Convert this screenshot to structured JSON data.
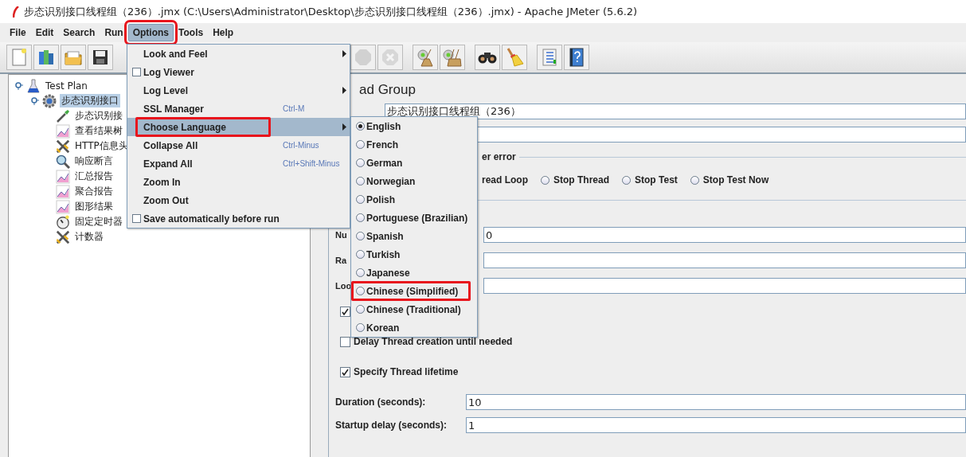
{
  "window": {
    "title": "步态识别接口线程组（236）.jmx (C:\\Users\\Administrator\\Desktop\\步态识别接口线程组（236）.jmx) - Apache JMeter (5.6.2)"
  },
  "menubar": [
    {
      "label": "File",
      "selected": false,
      "annotated": false
    },
    {
      "label": "Edit",
      "selected": false,
      "annotated": false
    },
    {
      "label": "Search",
      "selected": false,
      "annotated": false
    },
    {
      "label": "Run",
      "selected": false,
      "annotated": false
    },
    {
      "label": "Options",
      "selected": true,
      "annotated": true
    },
    {
      "label": "Tools",
      "selected": false,
      "annotated": false
    },
    {
      "label": "Help",
      "selected": false,
      "annotated": false
    }
  ],
  "toolbar_left": [
    {
      "kind": "new"
    },
    {
      "kind": "templates"
    },
    {
      "kind": "open"
    },
    {
      "kind": "save"
    }
  ],
  "toolbar_right": [
    {
      "kind": "stop",
      "disabled": true
    },
    {
      "kind": "shutdown",
      "disabled": true
    },
    {
      "kind": "clear"
    },
    {
      "kind": "clear-all"
    },
    {
      "kind": "search"
    },
    {
      "kind": "reset-search"
    },
    {
      "kind": "functions"
    },
    {
      "kind": "help"
    }
  ],
  "tree": {
    "label": "Test Plan",
    "kind": "plan",
    "selected": false,
    "expanded": true,
    "children": [
      {
        "label": "步态识别接口",
        "kind": "threadgroup",
        "selected": true,
        "expanded": true,
        "children": [
          {
            "label": "步态识别接",
            "kind": "sampler",
            "selected": false
          },
          {
            "label": "查看结果树",
            "kind": "listener",
            "selected": false
          },
          {
            "label": "HTTP信息头",
            "kind": "config",
            "selected": false
          },
          {
            "label": "响应断言",
            "kind": "assertion",
            "selected": false
          },
          {
            "label": "汇总报告",
            "kind": "listener",
            "selected": false
          },
          {
            "label": "聚合报告",
            "kind": "listener",
            "selected": false
          },
          {
            "label": "图形结果",
            "kind": "listener",
            "selected": false
          },
          {
            "label": "固定定时器",
            "kind": "timer",
            "selected": false
          },
          {
            "label": "计数器",
            "kind": "config",
            "selected": false
          }
        ]
      }
    ]
  },
  "options_menu": [
    {
      "kind": "submenu",
      "label": "Look and Feel",
      "selected": false,
      "annotated": false
    },
    {
      "kind": "check",
      "label": "Log Viewer",
      "checked": false,
      "selected": false,
      "annotated": false
    },
    {
      "kind": "submenu",
      "label": "Log Level",
      "selected": false,
      "annotated": false
    },
    {
      "kind": "plain",
      "label": "SSL Manager",
      "shortcut": "Ctrl-M",
      "selected": false,
      "annotated": false
    },
    {
      "kind": "submenu",
      "label": "Choose Language",
      "selected": true,
      "annotated": true
    },
    {
      "kind": "plain",
      "label": "Collapse All",
      "shortcut": "Ctrl-Minus",
      "selected": false,
      "annotated": false
    },
    {
      "kind": "plain",
      "label": "Expand All",
      "shortcut": "Ctrl+Shift-Minus",
      "selected": false,
      "annotated": false
    },
    {
      "kind": "plain",
      "label": "Zoom In",
      "selected": false,
      "annotated": false
    },
    {
      "kind": "plain",
      "label": "Zoom Out",
      "selected": false,
      "annotated": false
    },
    {
      "kind": "check",
      "label": "Save automatically before run",
      "checked": false,
      "selected": false,
      "annotated": false
    }
  ],
  "language_menu": [
    {
      "label": "English",
      "selected": true,
      "annotated": false
    },
    {
      "label": "French",
      "selected": false,
      "annotated": false
    },
    {
      "label": "German",
      "selected": false,
      "annotated": false
    },
    {
      "label": "Norwegian",
      "selected": false,
      "annotated": false
    },
    {
      "label": "Polish",
      "selected": false,
      "annotated": false
    },
    {
      "label": "Portuguese (Brazilian)",
      "selected": false,
      "annotated": false
    },
    {
      "label": "Spanish",
      "selected": false,
      "annotated": false
    },
    {
      "label": "Turkish",
      "selected": false,
      "annotated": false
    },
    {
      "label": "Japanese",
      "selected": false,
      "annotated": false
    },
    {
      "label": "Chinese (Simplified)",
      "selected": false,
      "annotated": true
    },
    {
      "label": "Chinese (Traditional)",
      "selected": false,
      "annotated": false
    },
    {
      "label": "Korean",
      "selected": false,
      "annotated": false
    }
  ],
  "thread_group": {
    "title": "ad Group",
    "name": "步态识别接口线程组（236）",
    "error_section_label": "er error",
    "error_action_fragment": "read Loop",
    "error_actions": [
      {
        "label": "Stop Thread",
        "selected": false
      },
      {
        "label": "Stop Test",
        "selected": false
      },
      {
        "label": "Stop Test Now",
        "selected": false
      }
    ],
    "properties": [
      {
        "label": "Nu",
        "value": "0"
      },
      {
        "label": "Ra"
      },
      {
        "label": "Loo"
      }
    ],
    "checkboxes": [
      {
        "checked": true
      },
      {
        "label": "Delay Thread creation until needed",
        "checked": false
      },
      {
        "label": "Specify Thread lifetime",
        "checked": true
      }
    ],
    "lifetime": [
      {
        "label": "Duration (seconds):",
        "value": "10"
      },
      {
        "label": "Startup delay (seconds):",
        "value": "1"
      }
    ]
  }
}
